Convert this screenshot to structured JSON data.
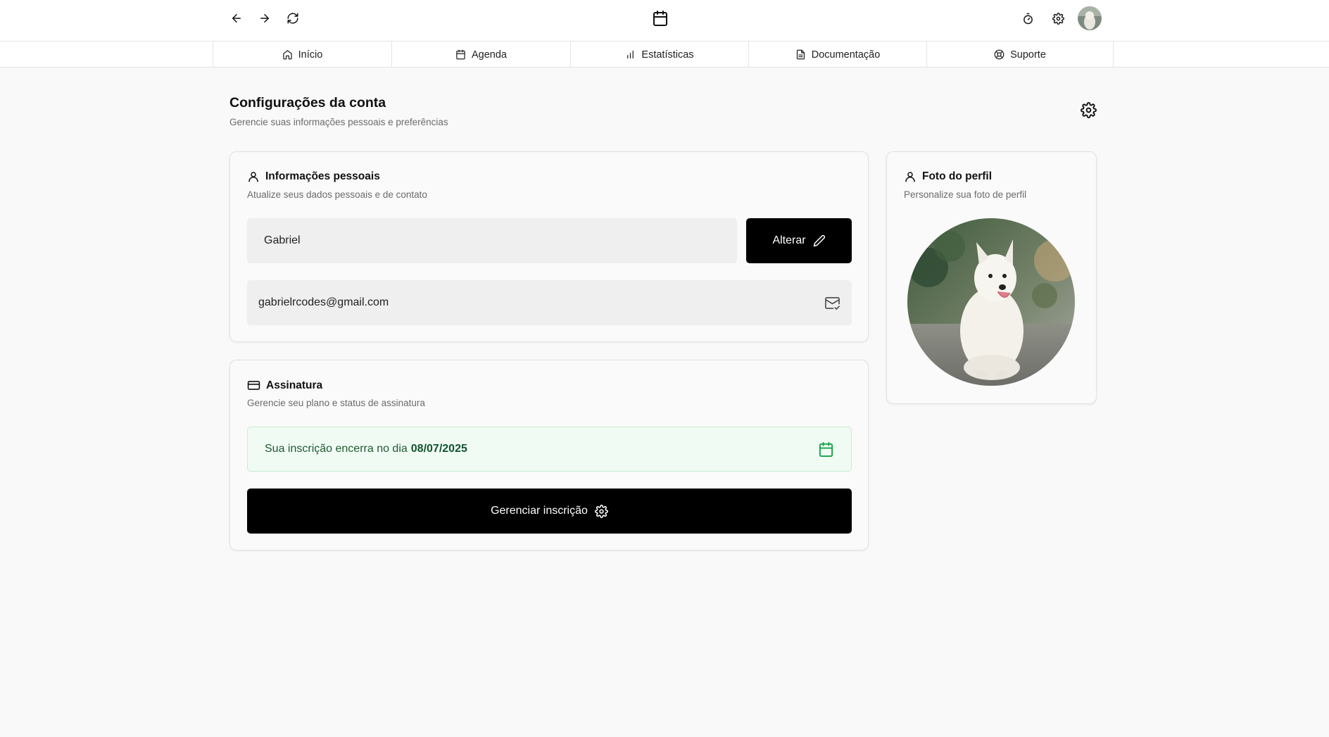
{
  "topbar": {
    "back_icon": "arrow-left-icon",
    "forward_icon": "arrow-right-icon",
    "refresh_icon": "refresh-icon",
    "app_icon": "calendar-icon",
    "timer_icon": "stopwatch-icon",
    "settings_icon": "gear-icon"
  },
  "nav": {
    "tabs": [
      {
        "label": "Início",
        "icon": "home-icon"
      },
      {
        "label": "Agenda",
        "icon": "calendar-icon"
      },
      {
        "label": "Estatísticas",
        "icon": "bar-chart-icon"
      },
      {
        "label": "Documentação",
        "icon": "document-icon"
      },
      {
        "label": "Suporte",
        "icon": "lifebuoy-icon"
      }
    ]
  },
  "page": {
    "title": "Configurações da conta",
    "subtitle": "Gerencie suas informações pessoais e preferências"
  },
  "personal": {
    "title": "Informações pessoais",
    "subtitle": "Atualize seus dados pessoais e de contato",
    "name_value": "Gabriel",
    "change_button": "Alterar",
    "email_value": "gabrielrcodes@gmail.com"
  },
  "subscription": {
    "title": "Assinatura",
    "subtitle": "Gerencie seu plano e status de assinatura",
    "notice_text": "Sua inscrição encerra no dia",
    "end_date": "08/07/2025",
    "manage_button": "Gerenciar inscrição"
  },
  "profile_photo": {
    "title": "Foto do perfil",
    "subtitle": "Personalize sua foto de perfil"
  },
  "colors": {
    "accent": "#000000",
    "notice_bg": "#f0fbf3",
    "notice_text": "#1f5a31",
    "calendar_green": "#16a34a"
  }
}
